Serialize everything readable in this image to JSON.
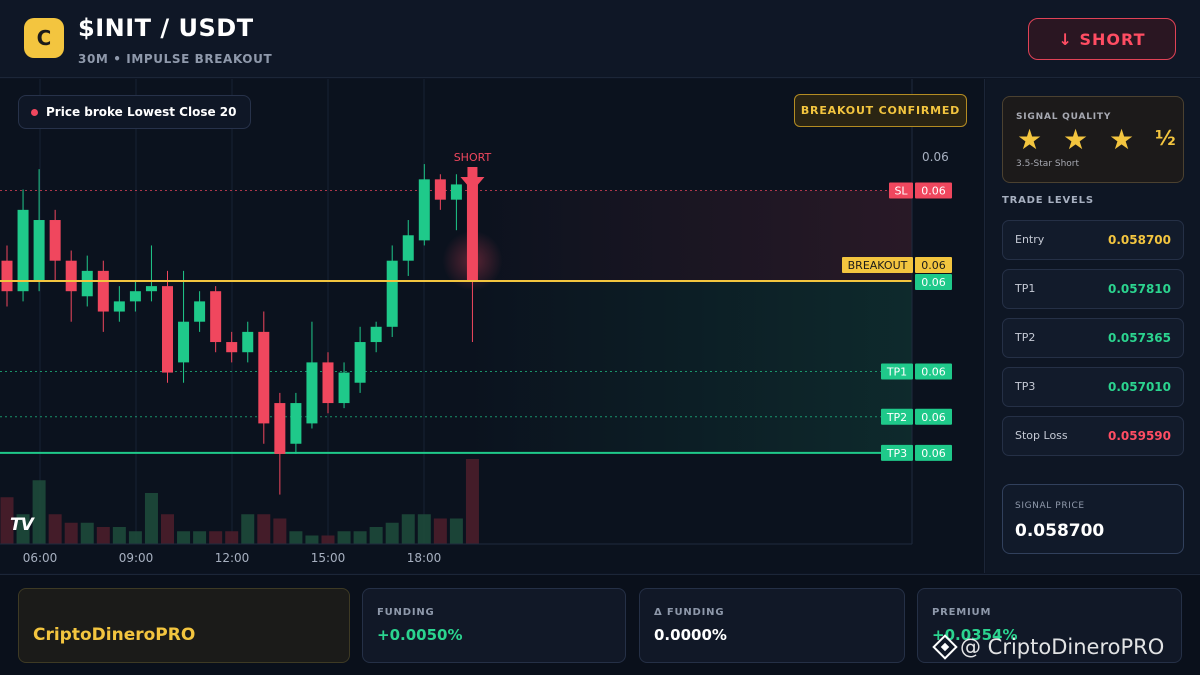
{
  "header": {
    "logo_letter": "C",
    "pair": "$INIT / USDT",
    "subtitle": "30M • IMPULSE BREAKOUT",
    "short_button": "↓ SHORT"
  },
  "chart": {
    "alert": "Price broke Lowest Close 20",
    "confirmed_badge": "BREAKOUT CONFIRMED",
    "signal_marker": "SHORT",
    "watermark_logo": "TV",
    "price_axis_top_label": "0.06",
    "level_tags": {
      "sl": {
        "label": "SL",
        "value": "0.06"
      },
      "breakout": {
        "label": "BREAKOUT",
        "value": "0.06"
      },
      "price": {
        "value": "0.06"
      },
      "tp1": {
        "label": "TP1",
        "value": "0.06"
      },
      "tp2": {
        "label": "TP2",
        "value": "0.06"
      },
      "tp3": {
        "label": "TP3",
        "value": "0.06"
      }
    },
    "time_labels": [
      "06:00",
      "09:00",
      "12:00",
      "15:00",
      "18:00"
    ]
  },
  "chart_data": {
    "type": "candlestick",
    "x_labels": [
      "06:00",
      "09:00",
      "12:00",
      "15:00",
      "18:00"
    ],
    "ylim": [
      0.05695,
      0.0599
    ],
    "candles": [
      {
        "o": 0.0589,
        "h": 0.05905,
        "c": 0.0586,
        "l": 0.05845
      },
      {
        "o": 0.0586,
        "h": 0.0596,
        "c": 0.0594,
        "l": 0.0585
      },
      {
        "o": 0.0587,
        "h": 0.0598,
        "c": 0.0593,
        "l": 0.0586
      },
      {
        "o": 0.0593,
        "h": 0.0594,
        "c": 0.0589,
        "l": 0.0587
      },
      {
        "o": 0.0589,
        "h": 0.059,
        "c": 0.0586,
        "l": 0.0583
      },
      {
        "o": 0.05855,
        "h": 0.05895,
        "c": 0.0588,
        "l": 0.05845
      },
      {
        "o": 0.0588,
        "h": 0.0589,
        "c": 0.0584,
        "l": 0.0582
      },
      {
        "o": 0.0584,
        "h": 0.05865,
        "c": 0.0585,
        "l": 0.0583
      },
      {
        "o": 0.0585,
        "h": 0.0587,
        "c": 0.0586,
        "l": 0.0584
      },
      {
        "o": 0.0586,
        "h": 0.05905,
        "c": 0.05865,
        "l": 0.0585
      },
      {
        "o": 0.05865,
        "h": 0.0588,
        "c": 0.0578,
        "l": 0.0577
      },
      {
        "o": 0.0579,
        "h": 0.0588,
        "c": 0.0583,
        "l": 0.0577
      },
      {
        "o": 0.0583,
        "h": 0.0586,
        "c": 0.0585,
        "l": 0.0582
      },
      {
        "o": 0.0586,
        "h": 0.05865,
        "c": 0.0581,
        "l": 0.058
      },
      {
        "o": 0.0581,
        "h": 0.0582,
        "c": 0.058,
        "l": 0.0579
      },
      {
        "o": 0.058,
        "h": 0.0583,
        "c": 0.0582,
        "l": 0.0579
      },
      {
        "o": 0.0582,
        "h": 0.0584,
        "c": 0.0573,
        "l": 0.0571
      },
      {
        "o": 0.0575,
        "h": 0.0576,
        "c": 0.057,
        "l": 0.0566
      },
      {
        "o": 0.0571,
        "h": 0.0576,
        "c": 0.0575,
        "l": 0.057
      },
      {
        "o": 0.0573,
        "h": 0.0583,
        "c": 0.0579,
        "l": 0.05725
      },
      {
        "o": 0.0579,
        "h": 0.058,
        "c": 0.0575,
        "l": 0.0574
      },
      {
        "o": 0.0575,
        "h": 0.0579,
        "c": 0.0578,
        "l": 0.05745
      },
      {
        "o": 0.0577,
        "h": 0.05825,
        "c": 0.0581,
        "l": 0.0576
      },
      {
        "o": 0.0581,
        "h": 0.0583,
        "c": 0.05825,
        "l": 0.058
      },
      {
        "o": 0.05825,
        "h": 0.05905,
        "c": 0.0589,
        "l": 0.05815
      },
      {
        "o": 0.0589,
        "h": 0.0593,
        "c": 0.05915,
        "l": 0.05875
      },
      {
        "o": 0.0591,
        "h": 0.05985,
        "c": 0.0597,
        "l": 0.05905
      },
      {
        "o": 0.0597,
        "h": 0.05975,
        "c": 0.0595,
        "l": 0.0594
      },
      {
        "o": 0.0595,
        "h": 0.05975,
        "c": 0.05965,
        "l": 0.0592
      },
      {
        "o": 0.0597,
        "h": 0.0598,
        "c": 0.0587,
        "l": 0.0581
      }
    ],
    "volumes": [
      0.55,
      0.35,
      0.75,
      0.35,
      0.25,
      0.25,
      0.2,
      0.2,
      0.15,
      0.6,
      0.35,
      0.15,
      0.15,
      0.15,
      0.15,
      0.35,
      0.35,
      0.3,
      0.15,
      0.1,
      0.1,
      0.15,
      0.15,
      0.2,
      0.25,
      0.35,
      0.35,
      0.3,
      0.3,
      1.0
    ],
    "levels": {
      "sl": 0.05959,
      "breakout": 0.0587,
      "tp1": 0.05781,
      "tp2": 0.057365,
      "tp3": 0.05701
    },
    "signal_index": 29
  },
  "sidebar": {
    "quality_title": "SIGNAL QUALITY",
    "stars": "★ ★ ★",
    "half_star": "½",
    "quality_sub": "3.5-Star Short",
    "levels_title": "TRADE LEVELS",
    "levels": [
      {
        "label": "Entry",
        "value": "0.058700",
        "color": "#f3c53f"
      },
      {
        "label": "TP1",
        "value": "0.057810",
        "color": "#2bd48f"
      },
      {
        "label": "TP2",
        "value": "0.057365",
        "color": "#2bd48f"
      },
      {
        "label": "TP3",
        "value": "0.057010",
        "color": "#2bd48f"
      },
      {
        "label": "Stop Loss",
        "value": "0.059590",
        "color": "#ff4d63"
      }
    ],
    "signal_price_title": "SIGNAL PRICE",
    "signal_price": "0.058700"
  },
  "bottom": {
    "brand": "CriptoDineroPRO",
    "metrics": [
      {
        "label": "FUNDING",
        "value": "+0.0050%",
        "color": "#2bd48f"
      },
      {
        "label": "Δ FUNDING",
        "value": "0.0000%",
        "color": "#ffffff"
      },
      {
        "label": "PREMIUM",
        "value": "+0.0354%",
        "color": "#2bd48f"
      }
    ],
    "watermark": "@ CriptoDineroPRO"
  },
  "colors": {
    "up": "#1fc98a",
    "down": "#f0475e",
    "breakout": "#f3c53f",
    "tp": "#1fc98a"
  }
}
